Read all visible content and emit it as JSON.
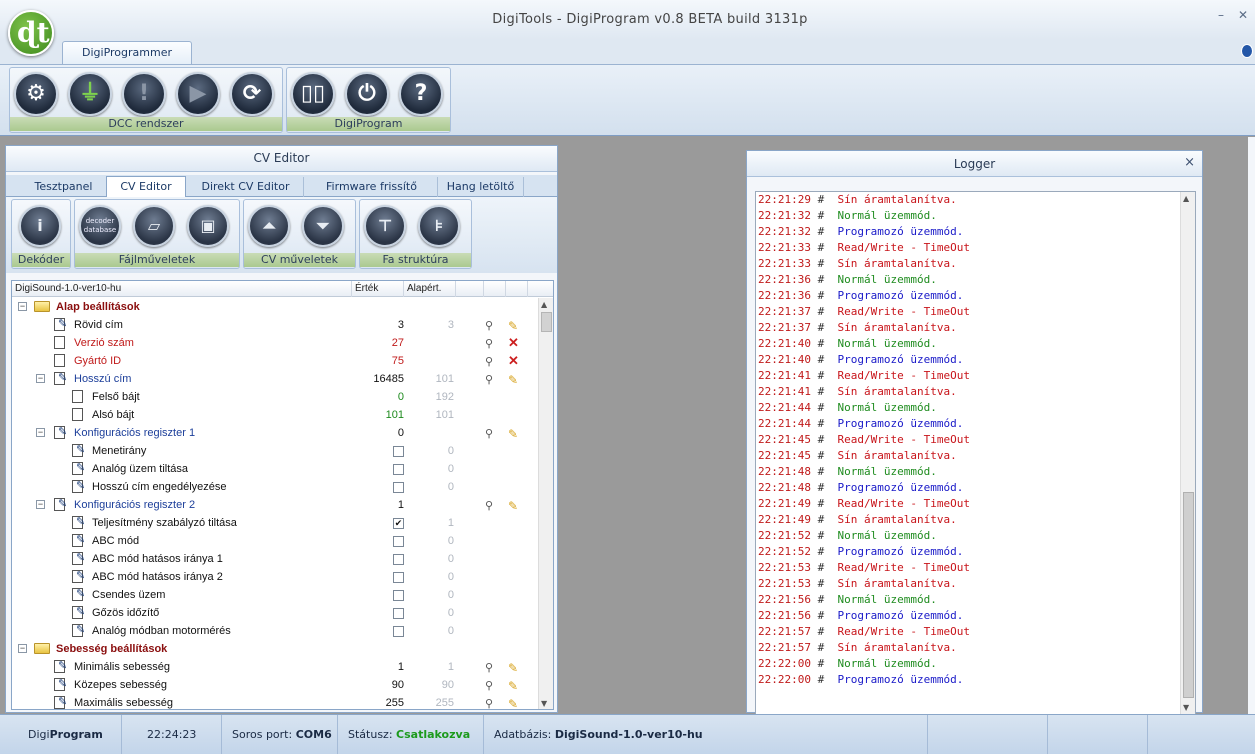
{
  "window": {
    "title": "DigiTools - DigiProgram v0.8 BETA build 3131p",
    "minimize": "–",
    "close": "✕"
  },
  "ribbon": {
    "tab": "DigiProgrammer",
    "groups": [
      {
        "label": "DCC rendszer"
      },
      {
        "label": "DigiProgram"
      }
    ]
  },
  "cv_panel": {
    "title": "CV Editor",
    "tabs": [
      "Tesztpanel",
      "CV Editor",
      "Direkt CV Editor",
      "Firmware frissítő",
      "Hang letöltő"
    ],
    "toolbar_groups": [
      "Dekóder",
      "Fájlműveletek",
      "CV műveletek",
      "Fa struktúra"
    ],
    "decoder_db_button": "decoder\ndatabase",
    "tree": {
      "headers": [
        "DigiSound-1.0-ver10-hu",
        "Érték",
        "Alapért."
      ],
      "rows": [
        {
          "label": "Alap beállítások",
          "level": 0,
          "type": "group"
        },
        {
          "label": "Rövid cím",
          "level": 1,
          "type": "pen",
          "value": "3",
          "default": "3",
          "color": "",
          "actions": "edit"
        },
        {
          "label": "Verzió szám",
          "level": 1,
          "type": "doc",
          "value": "27",
          "default": "",
          "color": "red",
          "actions": "del"
        },
        {
          "label": "Gyártó ID",
          "level": 1,
          "type": "doc",
          "value": "75",
          "default": "",
          "color": "red",
          "actions": "del"
        },
        {
          "label": "Hosszú cím",
          "level": 1,
          "type": "multi",
          "value": "16485",
          "default": "101",
          "color": "blue",
          "actions": "edit"
        },
        {
          "label": "Felső bájt",
          "level": 2,
          "type": "doc",
          "value": "0",
          "default": "192",
          "color": "",
          "valcolor": "green"
        },
        {
          "label": "Alsó bájt",
          "level": 2,
          "type": "doc",
          "value": "101",
          "default": "101",
          "color": "",
          "valcolor": "green"
        },
        {
          "label": "Konfigurációs regiszter 1",
          "level": 1,
          "type": "multi",
          "value": "0",
          "default": "",
          "color": "blue",
          "actions": "edit"
        },
        {
          "label": "Menetirány",
          "level": 2,
          "type": "pen",
          "check": false,
          "default": "0"
        },
        {
          "label": "Analóg üzem tiltása",
          "level": 2,
          "type": "pen",
          "check": false,
          "default": "0"
        },
        {
          "label": "Hosszú cím engedélyezése",
          "level": 2,
          "type": "pen",
          "check": false,
          "default": "0"
        },
        {
          "label": "Konfigurációs regiszter 2",
          "level": 1,
          "type": "multi",
          "value": "1",
          "default": "",
          "color": "blue",
          "actions": "edit"
        },
        {
          "label": "Teljesítmény szabályzó tiltása",
          "level": 2,
          "type": "pen",
          "check": true,
          "default": "1"
        },
        {
          "label": "ABC mód",
          "level": 2,
          "type": "pen",
          "check": false,
          "default": "0"
        },
        {
          "label": "ABC mód hatásos iránya 1",
          "level": 2,
          "type": "pen",
          "check": false,
          "default": "0"
        },
        {
          "label": "ABC mód hatásos iránya 2",
          "level": 2,
          "type": "pen",
          "check": false,
          "default": "0"
        },
        {
          "label": "Csendes üzem",
          "level": 2,
          "type": "pen",
          "check": false,
          "default": "0"
        },
        {
          "label": "Gőzös időzítő",
          "level": 2,
          "type": "pen",
          "check": false,
          "default": "0"
        },
        {
          "label": "Analóg módban motormérés",
          "level": 2,
          "type": "pen",
          "check": false,
          "default": "0"
        },
        {
          "label": "Sebesség beállítások",
          "level": 0,
          "type": "group"
        },
        {
          "label": "Minimális sebesség",
          "level": 1,
          "type": "pen",
          "value": "1",
          "default": "1",
          "color": "",
          "actions": "edit"
        },
        {
          "label": "Közepes sebesség",
          "level": 1,
          "type": "pen",
          "value": "90",
          "default": "90",
          "color": "",
          "actions": "edit"
        },
        {
          "label": "Maximális sebesség",
          "level": 1,
          "type": "pen",
          "value": "255",
          "default": "255",
          "color": "",
          "actions": "edit"
        }
      ]
    }
  },
  "logger": {
    "title": "Logger",
    "close": "×",
    "lines": [
      {
        "time": "22:21:29",
        "msg": "Sín áramtalanítva.",
        "color": "red"
      },
      {
        "time": "22:21:32",
        "msg": "Normál üzemmód.",
        "color": "green"
      },
      {
        "time": "22:21:32",
        "msg": "Programozó üzemmód.",
        "color": "blue"
      },
      {
        "time": "22:21:33",
        "msg": "Read/Write - TimeOut",
        "color": "red"
      },
      {
        "time": "22:21:33",
        "msg": "Sín áramtalanítva.",
        "color": "red"
      },
      {
        "time": "22:21:36",
        "msg": "Normál üzemmód.",
        "color": "green"
      },
      {
        "time": "22:21:36",
        "msg": "Programozó üzemmód.",
        "color": "blue"
      },
      {
        "time": "22:21:37",
        "msg": "Read/Write - TimeOut",
        "color": "red"
      },
      {
        "time": "22:21:37",
        "msg": "Sín áramtalanítva.",
        "color": "red"
      },
      {
        "time": "22:21:40",
        "msg": "Normál üzemmód.",
        "color": "green"
      },
      {
        "time": "22:21:40",
        "msg": "Programozó üzemmód.",
        "color": "blue"
      },
      {
        "time": "22:21:41",
        "msg": "Read/Write - TimeOut",
        "color": "red"
      },
      {
        "time": "22:21:41",
        "msg": "Sín áramtalanítva.",
        "color": "red"
      },
      {
        "time": "22:21:44",
        "msg": "Normál üzemmód.",
        "color": "green"
      },
      {
        "time": "22:21:44",
        "msg": "Programozó üzemmód.",
        "color": "blue"
      },
      {
        "time": "22:21:45",
        "msg": "Read/Write - TimeOut",
        "color": "red"
      },
      {
        "time": "22:21:45",
        "msg": "Sín áramtalanítva.",
        "color": "red"
      },
      {
        "time": "22:21:48",
        "msg": "Normál üzemmód.",
        "color": "green"
      },
      {
        "time": "22:21:48",
        "msg": "Programozó üzemmód.",
        "color": "blue"
      },
      {
        "time": "22:21:49",
        "msg": "Read/Write - TimeOut",
        "color": "red"
      },
      {
        "time": "22:21:49",
        "msg": "Sín áramtalanítva.",
        "color": "red"
      },
      {
        "time": "22:21:52",
        "msg": "Normál üzemmód.",
        "color": "green"
      },
      {
        "time": "22:21:52",
        "msg": "Programozó üzemmód.",
        "color": "blue"
      },
      {
        "time": "22:21:53",
        "msg": "Read/Write - TimeOut",
        "color": "red"
      },
      {
        "time": "22:21:53",
        "msg": "Sín áramtalanítva.",
        "color": "red"
      },
      {
        "time": "22:21:56",
        "msg": "Normál üzemmód.",
        "color": "green"
      },
      {
        "time": "22:21:56",
        "msg": "Programozó üzemmód.",
        "color": "blue"
      },
      {
        "time": "22:21:57",
        "msg": "Read/Write - TimeOut",
        "color": "red"
      },
      {
        "time": "22:21:57",
        "msg": "Sín áramtalanítva.",
        "color": "red"
      },
      {
        "time": "22:22:00",
        "msg": "Normál üzemmód.",
        "color": "green"
      },
      {
        "time": "22:22:00",
        "msg": "Programozó üzemmód.",
        "color": "blue"
      }
    ]
  },
  "statusbar": {
    "app_prefix": "Digi",
    "app_name": "Program",
    "clock": "22:24:23",
    "port_label": "Soros port:",
    "port_value": "COM6",
    "status_label": "Státusz:",
    "status_value": "Csatlakozva",
    "db_label": "Adatbázis:",
    "db_value": "DigiSound-1.0-ver10-hu"
  },
  "colors": {
    "status_ok": "#1c9a1c",
    "log_red": "#c8141a",
    "log_green": "#1f8c1f",
    "log_blue": "#1a1ac8",
    "group_label": "#8a0e0e"
  }
}
